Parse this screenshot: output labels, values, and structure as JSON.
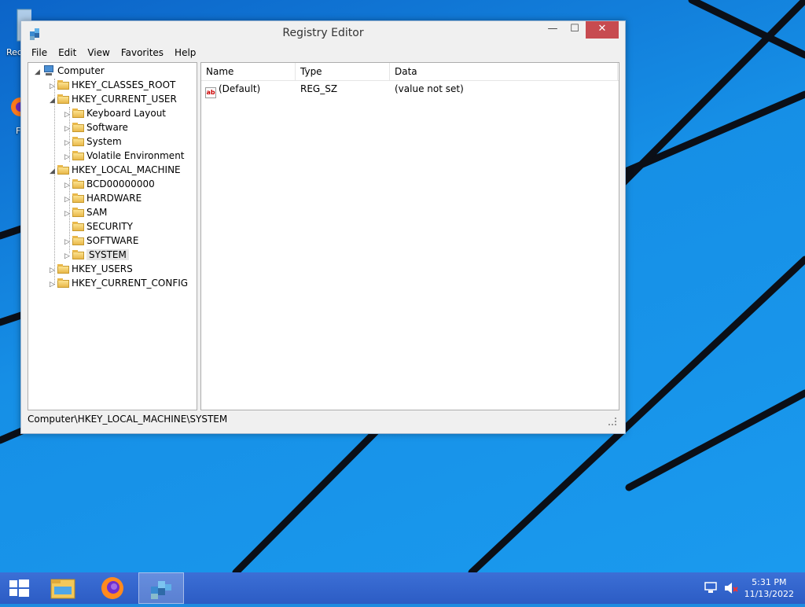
{
  "desktop": {
    "icons": [
      {
        "name": "recycle-bin",
        "label": "Rec"
      },
      {
        "name": "firefox-shortcut",
        "label": "F"
      }
    ]
  },
  "window": {
    "title": "Registry Editor",
    "controls": {
      "minimize": "—",
      "maximize": "☐",
      "close": "✕"
    }
  },
  "menu": [
    "File",
    "Edit",
    "View",
    "Favorites",
    "Help"
  ],
  "tree": {
    "root": "Computer",
    "items": [
      {
        "label": "HKEY_CLASSES_ROOT",
        "expander": "▷"
      },
      {
        "label": "HKEY_CURRENT_USER",
        "expander": "◢"
      },
      {
        "label": "Keyboard Layout",
        "expander": "▷"
      },
      {
        "label": "Software",
        "expander": "▷"
      },
      {
        "label": "System",
        "expander": "▷"
      },
      {
        "label": "Volatile Environment",
        "expander": "▷"
      },
      {
        "label": "HKEY_LOCAL_MACHINE",
        "expander": "◢"
      },
      {
        "label": "BCD00000000",
        "expander": "▷"
      },
      {
        "label": "HARDWARE",
        "expander": "▷"
      },
      {
        "label": "SAM",
        "expander": "▷"
      },
      {
        "label": "SECURITY",
        "expander": ""
      },
      {
        "label": "SOFTWARE",
        "expander": "▷"
      },
      {
        "label": "SYSTEM",
        "expander": "▷"
      },
      {
        "label": "HKEY_USERS",
        "expander": "▷"
      },
      {
        "label": "HKEY_CURRENT_CONFIG",
        "expander": "▷"
      }
    ]
  },
  "list": {
    "columns": [
      "Name",
      "Type",
      "Data"
    ],
    "rows": [
      {
        "icon": "ab",
        "name": "(Default)",
        "type": "REG_SZ",
        "data": "(value not set)"
      }
    ]
  },
  "status": {
    "path": "Computer\\HKEY_LOCAL_MACHINE\\SYSTEM"
  },
  "taskbar": {
    "clock_time": "5:31 PM",
    "clock_date": "11/13/2022"
  },
  "colors": {
    "accent": "#2c5cc4",
    "close": "#c74b50",
    "desktop": "#1a8fe6"
  }
}
